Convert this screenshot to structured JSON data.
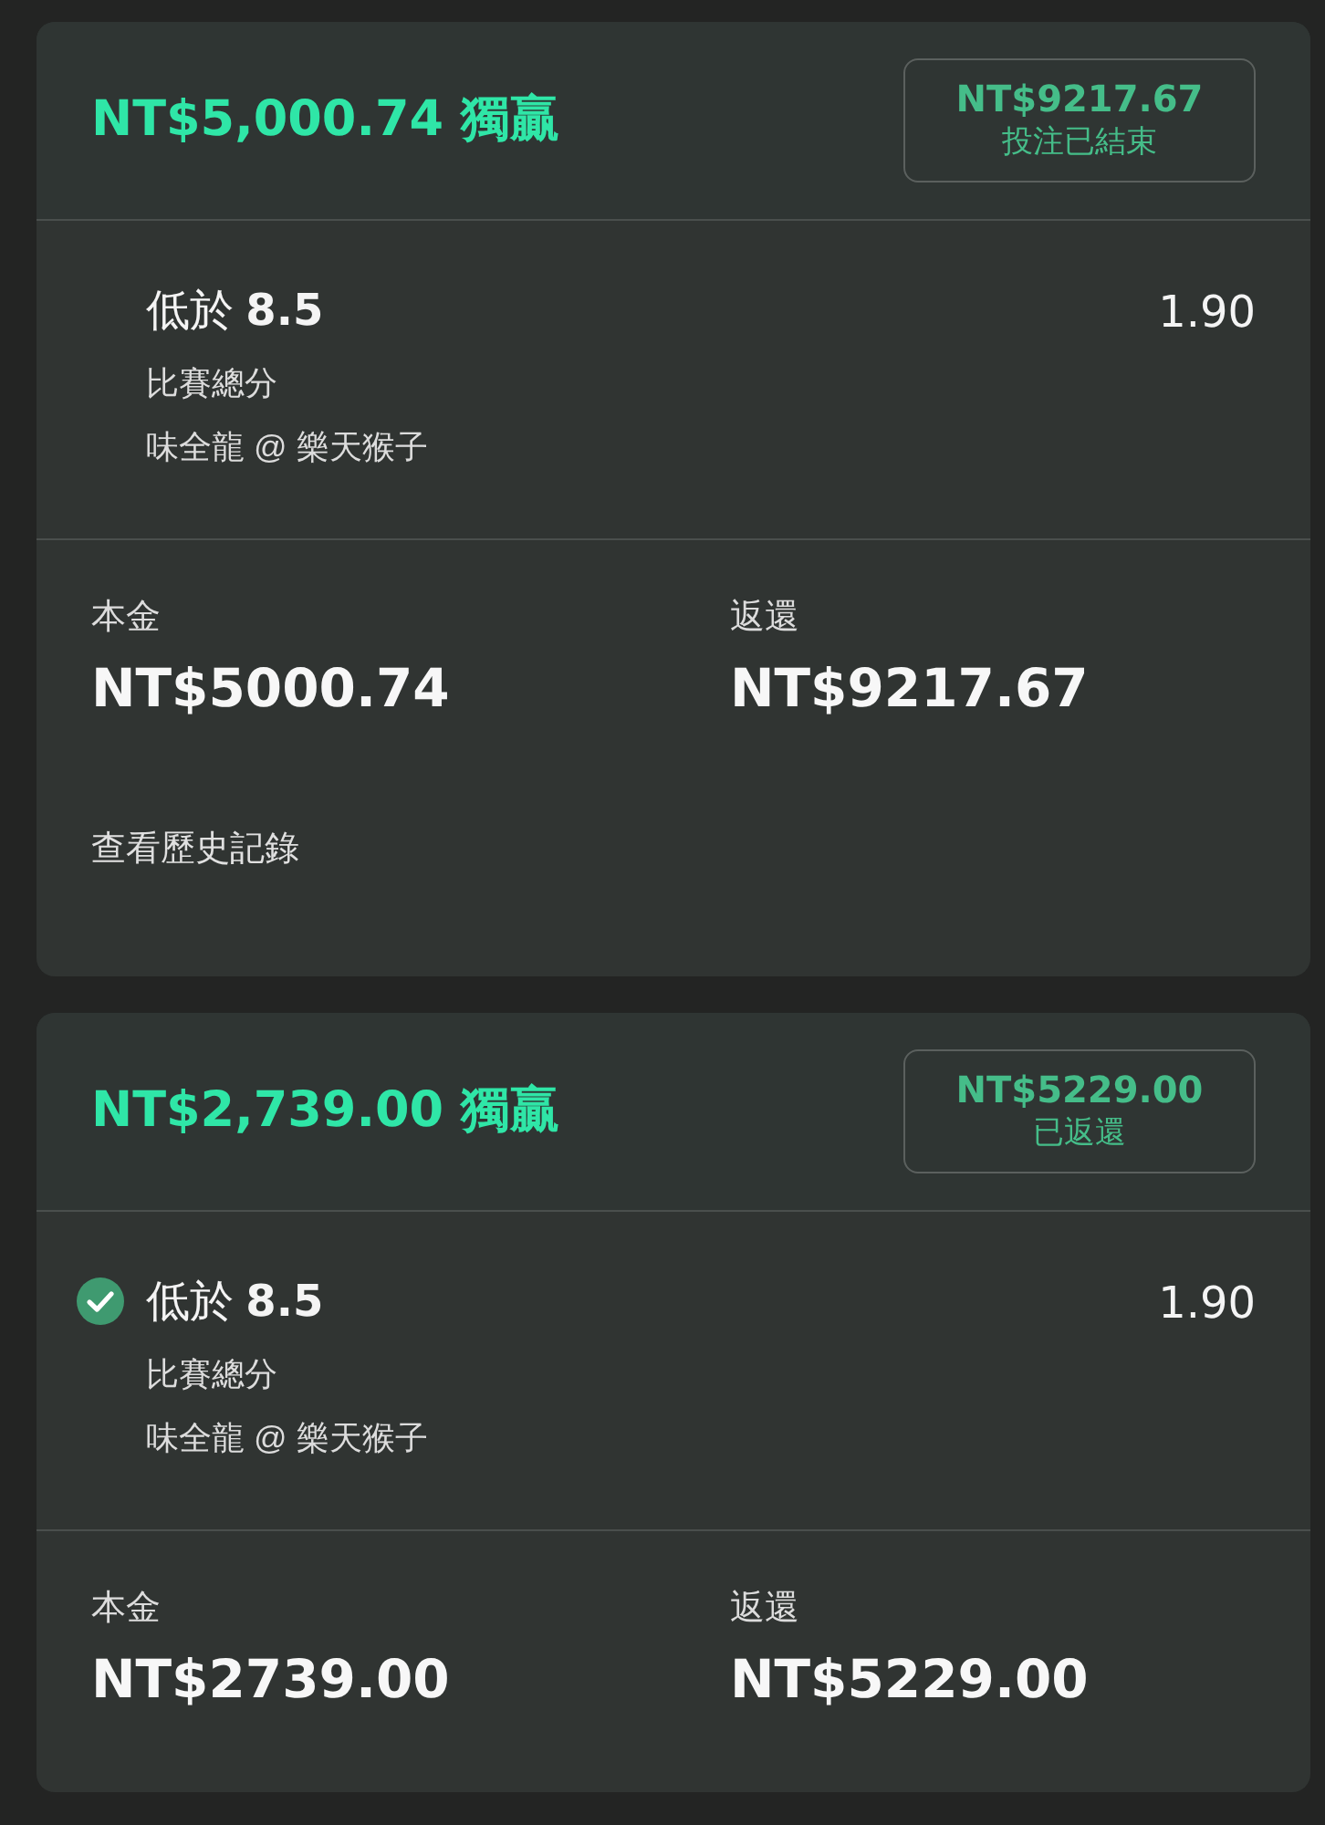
{
  "bets": [
    {
      "title": "NT$5,000.74 獨贏",
      "status": {
        "amount": "NT$9217.67",
        "label": "投注已結束"
      },
      "selections": [
        {
          "pick": "低於 **8.5**",
          "checked": false,
          "odds": "1.90",
          "market": "比賽總分",
          "event": "味全龍 @ 樂天猴子"
        }
      ],
      "stake": {
        "label": "本金",
        "value": "NT$5000.74"
      },
      "returns": {
        "label": "返還",
        "value": "NT$9217.67"
      },
      "history_link": "查看歷史記錄"
    },
    {
      "title": "NT$2,739.00 獨贏",
      "status": {
        "amount": "NT$5229.00",
        "label": "已返還"
      },
      "selections": [
        {
          "pick": "低於 **8.5**",
          "checked": true,
          "odds": "1.90",
          "market": "比賽總分",
          "event": "味全龍 @ 樂天猴子"
        }
      ],
      "stake": {
        "label": "本金",
        "value": "NT$2739.00"
      },
      "returns": {
        "label": "返還",
        "value": "NT$5229.00"
      }
    }
  ]
}
